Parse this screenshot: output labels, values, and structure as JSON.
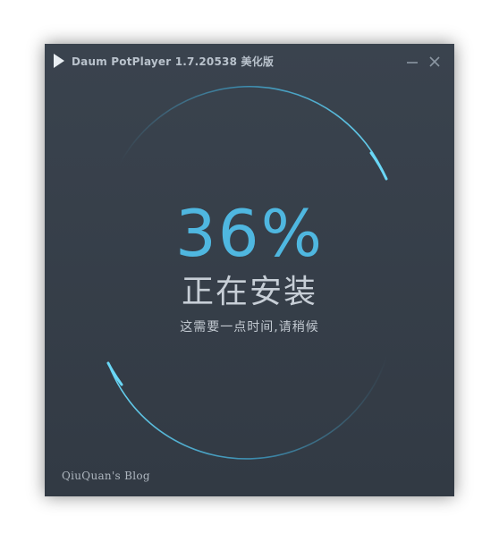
{
  "window": {
    "title": "Daum PotPlayer 1.7.20538 美化版",
    "minimize_icon": "minimize-icon",
    "close_icon": "close-icon",
    "app_icon": "play-icon"
  },
  "installer": {
    "progress_text": "36%",
    "progress_value": 0.36,
    "status": "正在安装",
    "hint": "这需要一点时间,请稍候"
  },
  "footer": {
    "credit": "QiuQuan's Blog"
  },
  "colors": {
    "background": "#36404b",
    "accent": "#4fb7e0",
    "ring_bright": "#5fd0f2",
    "text": "#c7ced6"
  }
}
